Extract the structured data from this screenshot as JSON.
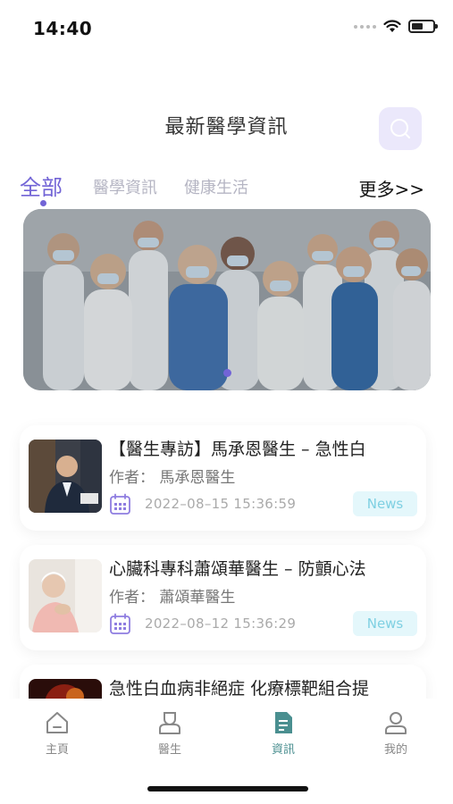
{
  "status": {
    "time": "14:40"
  },
  "header": {
    "title": "最新醫學資訊"
  },
  "tabs": [
    {
      "label": "全部"
    },
    {
      "label": "醫學資訊"
    },
    {
      "label": "健康生活"
    }
  ],
  "more_label": "更多>>",
  "banner": {
    "image": "medical-team-photo",
    "slides": 1,
    "active_slide": 1
  },
  "news": [
    {
      "title": "【醫生專訪】馬承恩醫生 – 急性白",
      "author": "作者：  馬承恩醫生",
      "date": "2022–08–15 15:36:59",
      "tag": "News"
    },
    {
      "title": "心臟科專科蕭頌華醫生 – 防顫心法",
      "author": "作者：  蕭頌華醫生",
      "date": "2022–08–12 15:36:29",
      "tag": "News"
    },
    {
      "title": "急性白血病非絕症 化療標靶組合提",
      "author": "",
      "date": "",
      "tag": ""
    }
  ],
  "bottom_nav": [
    {
      "label": "主頁",
      "icon": "home-icon"
    },
    {
      "label": "醫生",
      "icon": "doctor-icon"
    },
    {
      "label": "資訊",
      "icon": "news-icon"
    },
    {
      "label": "我的",
      "icon": "profile-icon"
    }
  ],
  "colors": {
    "accent": "#7264d6",
    "tag_bg": "#e4f7fb",
    "tag_text": "#7fd0e2",
    "nav_active": "#4a8f90"
  }
}
